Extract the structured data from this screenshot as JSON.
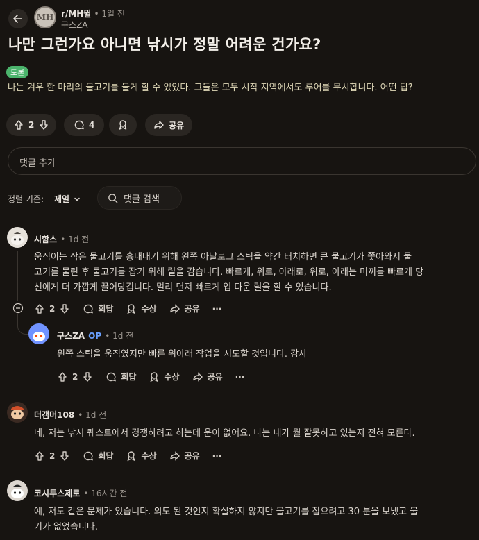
{
  "header": {
    "subreddit": "r/MH윌",
    "time": "• 1일 전",
    "author": "구스ZA",
    "avatar_text": "MH"
  },
  "post": {
    "title": "나만 그런가요 아니면 낚시가 정말 어려운 건가요?",
    "flair": "토론",
    "body": "나는 겨우 한 마리의 물고기를 물게 할 수 있었다. 그들은 모두 시작 지역에서도 루어를 무시합니다. 어떤 팁?",
    "votes": "2",
    "comments": "4",
    "share": "공유"
  },
  "comment_input": {
    "placeholder": "댓글 추가"
  },
  "sort": {
    "label": "정렬 기준:",
    "value": "제일",
    "search": "댓글 검색"
  },
  "actions": {
    "reply": "회답",
    "award": "수상",
    "share": "공유",
    "more": "···"
  },
  "comments": [
    {
      "author": "시함스",
      "time": "• 1d 전",
      "body": [
        "움직이는 작은 물고기를 흉내내기 위해 왼쪽 아날로그 스틱을 약간 터치하면 큰 물고기가 쫓아와서 물",
        "고기를 물린 후 물고기를 잡기 위해 릴을 감습니다. 빠르게, 위로, 아래로, 위로, 아래는 미끼를 빠르게 당",
        "신에게 더 가깝게 끌어당깁니다. 멀리 던져 빠르게 업 다운 릴을 할 수 있습니다."
      ],
      "votes": "2"
    },
    {
      "author": "구스ZA",
      "op": "OP",
      "time": "• 1d 전",
      "body": [
        "왼쪽 스틱을 움직였지만 빠른 위아래 작업을 시도할 것입니다. 감사"
      ],
      "votes": "2"
    },
    {
      "author": "더갬머108",
      "time": "• 1d 전",
      "body": [
        "네, 저는 낚시 퀘스트에서 경쟁하려고 하는데 운이 없어요. 나는 내가 뭘 잘못하고 있는지 전혀 모른다."
      ],
      "votes": "2"
    },
    {
      "author": "코시투스제로",
      "time": "• 16시간 전",
      "body": [
        "예, 저도 같은 문제가 있습니다. 의도 된 것인지 확실하지 않지만 물고기를 잡으려고 30 분을 보냈고 물",
        "기가 없었습니다."
      ]
    }
  ],
  "colors": {
    "background": "#171411",
    "flair": "#4bb46c",
    "op": "#6aa0ff"
  }
}
